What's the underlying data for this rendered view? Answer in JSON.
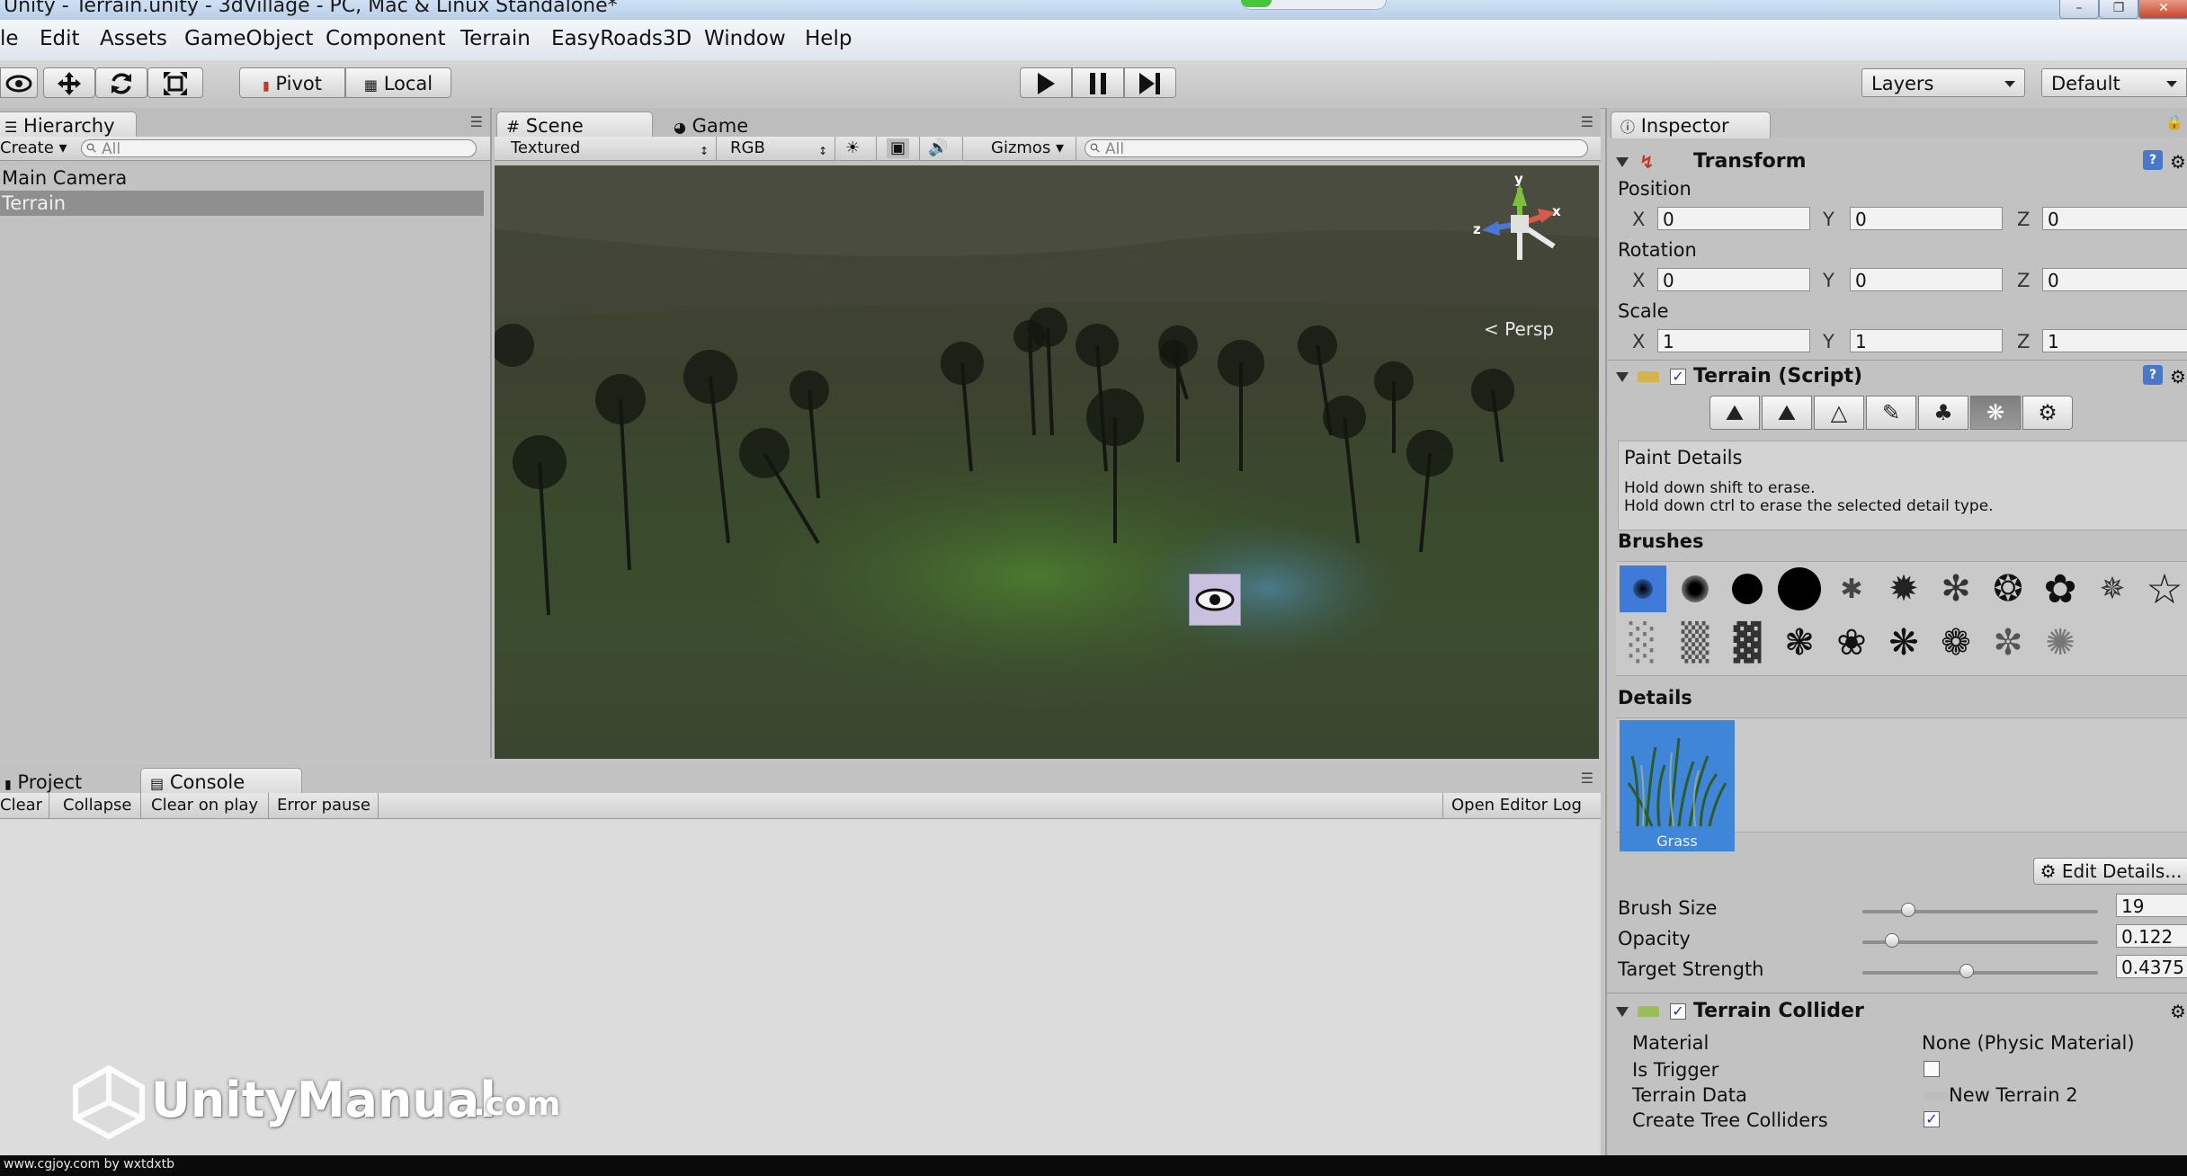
{
  "window": {
    "title": "Unity - Terrain.unity - 3dVillage - PC, Mac & Linux Standalone*"
  },
  "menu": [
    "File",
    "Edit",
    "Assets",
    "GameObject",
    "Component",
    "Terrain",
    "EasyRoads3D",
    "Window",
    "Help"
  ],
  "toolbar": {
    "pivot": "Pivot",
    "local": "Local",
    "layers": "Layers",
    "layout": "Default"
  },
  "hierarchy": {
    "tab": "Hierarchy",
    "create": "Create",
    "search": "All",
    "items": [
      {
        "name": "Main Camera",
        "selected": false
      },
      {
        "name": "Terrain",
        "selected": true
      }
    ]
  },
  "scene": {
    "tab_scene": "Scene",
    "tab_game": "Game",
    "render_mode": "Textured",
    "color_mode": "RGB",
    "gizmos": "Gizmos",
    "search": "All",
    "projection": "Persp",
    "gizmo_axes": {
      "y": "y",
      "x": "x",
      "z": "z"
    }
  },
  "console": {
    "tab_project": "Project",
    "tab_console": "Console",
    "clear": "Clear",
    "collapse": "Collapse",
    "clear_on_play": "Clear on play",
    "error_pause": "Error pause",
    "open_log": "Open Editor Log"
  },
  "watermark": {
    "brand": "UnityManual",
    "tld": ".com",
    "credit": "www.cgjoy.com by wxtdxtb"
  },
  "inspector": {
    "tab": "Inspector",
    "transform": {
      "title": "Transform",
      "position_label": "Position",
      "rotation_label": "Rotation",
      "scale_label": "Scale",
      "position": {
        "x": "0",
        "y": "0",
        "z": "0"
      },
      "rotation": {
        "x": "0",
        "y": "0",
        "z": "0"
      },
      "scale": {
        "x": "1",
        "y": "1",
        "z": "1"
      },
      "axis_x": "X",
      "axis_y": "Y",
      "axis_z": "Z"
    },
    "terrain_script": {
      "title": "Terrain (Script)",
      "tools": [
        "raise-lower-icon",
        "paint-height-icon",
        "smooth-height-icon",
        "paint-texture-icon",
        "place-trees-icon",
        "paint-details-icon",
        "settings-icon"
      ],
      "active_tool": 5,
      "help_title": "Paint Details",
      "help_line1": "Hold down shift to erase.",
      "help_line2": "Hold down ctrl to erase the selected detail type.",
      "brushes_label": "Brushes",
      "details_label": "Details",
      "detail_item": "Grass",
      "edit_details": "Edit Details...",
      "brush_size_label": "Brush Size",
      "brush_size": "19",
      "opacity_label": "Opacity",
      "opacity": "0.122",
      "strength_label": "Target Strength",
      "strength": "0.4375",
      "brush_size_fraction": 0.19,
      "opacity_fraction": 0.122,
      "strength_fraction": 0.4375
    },
    "collider": {
      "title": "Terrain Collider",
      "material_label": "Material",
      "material": "None (Physic Material)",
      "trigger_label": "Is Trigger",
      "trigger": false,
      "data_label": "Terrain Data",
      "data": "New Terrain 2",
      "trees_label": "Create Tree Colliders",
      "trees": true
    }
  }
}
